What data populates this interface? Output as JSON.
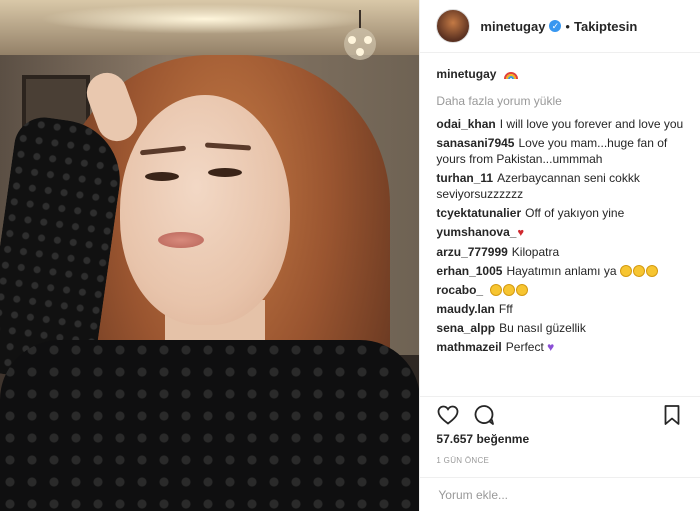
{
  "post": {
    "username": "minetugay",
    "separator": "•",
    "follow_status": "Takiptesin",
    "verified_glyph": "✓",
    "caption_user": "minetugay",
    "caption_emoji": "rainbow-emoji",
    "load_more": "Daha fazla yorum yükle",
    "comments": [
      {
        "user": "odai_khan",
        "text": "I will love you forever and love you"
      },
      {
        "user": "sanasani7945",
        "text": "Love you mam...huge fan of yours from Pakistan...ummmah"
      },
      {
        "user": "turhan_11",
        "text": "Azerbaycannan seni cokkk seviyorsuzzzzzz"
      },
      {
        "user": "tcyektatunalier",
        "text": "Off of yakıyon yine"
      },
      {
        "user": "yumshanova_",
        "text": "",
        "emoji": "heart"
      },
      {
        "user": "arzu_777999",
        "text": "Kilopatra"
      },
      {
        "user": "erhan_1005",
        "text": "Hayatımın anlamı ya",
        "emoji": "laugh-x3"
      },
      {
        "user": "rocabo_",
        "text": "",
        "emoji": "laugh-x3"
      },
      {
        "user": "maudy.lan",
        "text": "Fff"
      },
      {
        "user": "sena_alpp",
        "text": "Bu nasıl güzellik"
      },
      {
        "user": "mathmazeil",
        "text": "Perfect",
        "emoji": "purple-heart"
      }
    ],
    "likes": "57.657 beğenme",
    "time": "1 GÜN ÖNCE",
    "comment_placeholder": "Yorum ekle..."
  },
  "colors": {
    "accent": "#3897f0",
    "text": "#262626",
    "muted": "#999999"
  },
  "icons": [
    "heart-icon",
    "comment-icon",
    "bookmark-icon",
    "verified-icon"
  ]
}
